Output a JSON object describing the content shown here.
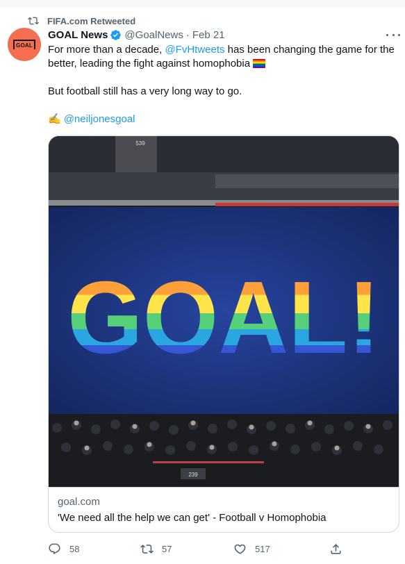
{
  "retweet_banner": {
    "text": "FIFA.com Retweeted"
  },
  "author": {
    "avatar_text": "GOAL",
    "name": "GOAL News",
    "handle": "@GoalNews",
    "separator": "·",
    "date": "Feb 21",
    "verified": true
  },
  "tweet": {
    "line1_pre": "For more than a decade, ",
    "mention1": "@FvHtweets",
    "line1_post": " has been changing the game for the better, leading the fight against homophobia",
    "line2": "But football still has a very long way to go.",
    "credit_emoji": "✍️",
    "mention2": "@neiljonesgoal"
  },
  "card": {
    "image_text": "GOAL!",
    "stand_number_top": "539",
    "stand_number_bottom": "239",
    "domain": "goal.com",
    "title": "'We need all the help we can get' - Football v Homophobia"
  },
  "actions": {
    "replies": "58",
    "retweets": "57",
    "likes": "517"
  },
  "colors": {
    "accent": "#1d9bf0",
    "avatar_bg": "#f36f4f",
    "muted_text": "#536471"
  }
}
